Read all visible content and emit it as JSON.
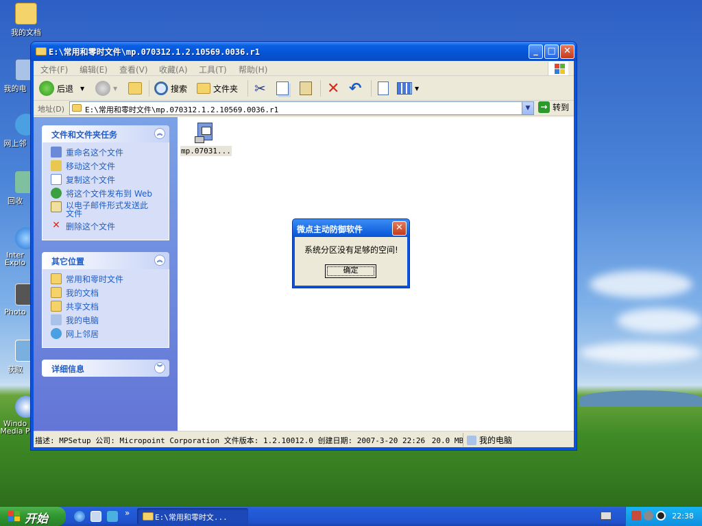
{
  "desktop": {
    "icons": [
      {
        "label": "我的文档"
      },
      {
        "label": "我的电"
      },
      {
        "label": "网上邻"
      },
      {
        "label": "回收"
      },
      {
        "label": "Inter Explo"
      },
      {
        "label": "Photo"
      },
      {
        "label": "获取"
      },
      {
        "label": "Windo Media P"
      }
    ]
  },
  "window": {
    "title": "E:\\常用和零时文件\\mp.070312.1.2.10569.0036.r1",
    "controls": {
      "minimize": "_",
      "maximize": "□",
      "close": "✕"
    },
    "menu": [
      "文件(F)",
      "编辑(E)",
      "查看(V)",
      "收藏(A)",
      "工具(T)",
      "帮助(H)"
    ],
    "toolbar": {
      "back": "后退",
      "search": "搜索",
      "folders": "文件夹"
    },
    "address": {
      "label": "地址(D)",
      "value": "E:\\常用和零时文件\\mp.070312.1.2.10569.0036.r1",
      "go": "转到"
    },
    "tasks": {
      "file_tasks": {
        "title": "文件和文件夹任务",
        "items": [
          "重命名这个文件",
          "移动这个文件",
          "复制这个文件",
          "将这个文件发布到 Web",
          "以电子邮件形式发送此文件",
          "删除这个文件"
        ]
      },
      "other_places": {
        "title": "其它位置",
        "items": [
          "常用和零时文件",
          "我的文档",
          "共享文档",
          "我的电脑",
          "网上邻居"
        ]
      },
      "details": {
        "title": "详细信息"
      }
    },
    "file": {
      "name": "mp.07031..."
    },
    "status": {
      "description": "描述: MPSetup 公司: Micropoint Corporation 文件版本: 1.2.10012.0 创建日期: 2007-3-20 22:26",
      "size": "20.0 MB",
      "location": "我的电脑"
    }
  },
  "dialog": {
    "title": "微点主动防御软件",
    "message": "系统分区没有足够的空间!",
    "ok": "确定"
  },
  "taskbar": {
    "start": "开始",
    "task_label": "E:\\常用和零时文...",
    "chevron": "»",
    "clock": "22:38"
  }
}
